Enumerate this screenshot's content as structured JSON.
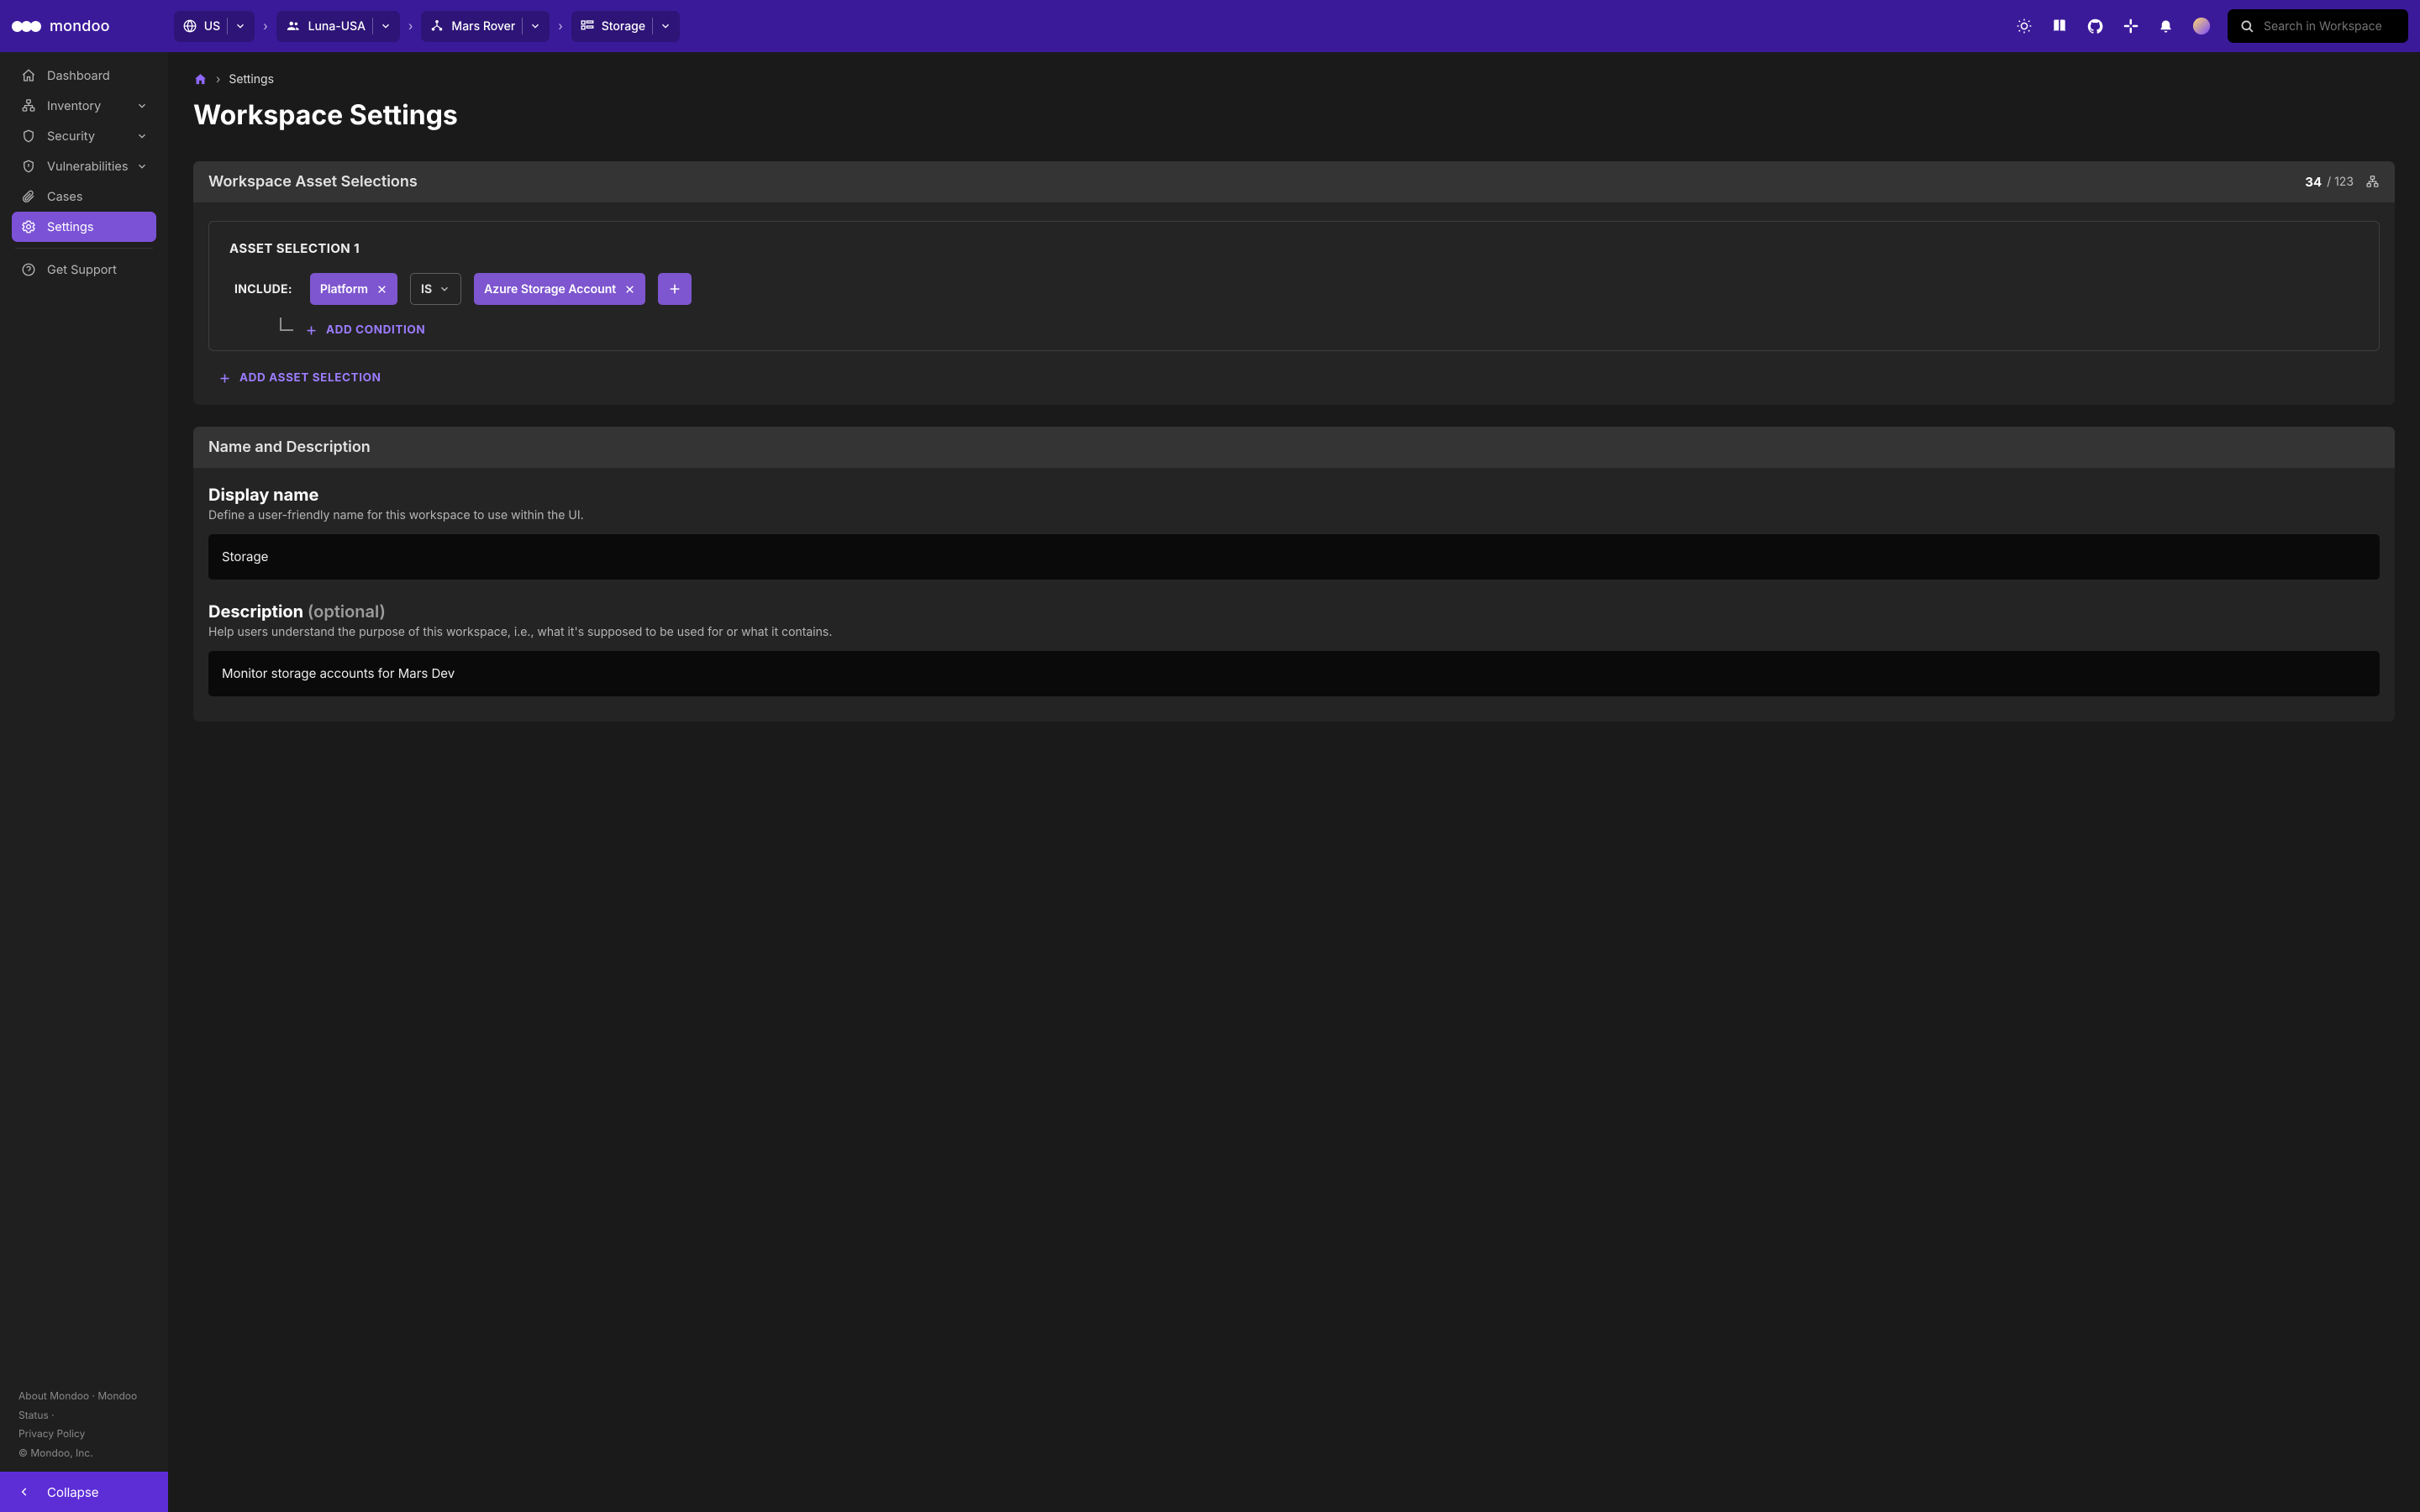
{
  "brand": "mondoo",
  "crumbs": [
    {
      "icon": "globe",
      "label": "US"
    },
    {
      "icon": "group",
      "label": "Luna-USA"
    },
    {
      "icon": "tree",
      "label": "Mars Rover"
    },
    {
      "icon": "workspace",
      "label": "Storage"
    }
  ],
  "search_placeholder": "Search in Workspace",
  "sidebar": {
    "items": [
      {
        "icon": "home",
        "label": "Dashboard",
        "expandable": false
      },
      {
        "icon": "inv",
        "label": "Inventory",
        "expandable": true
      },
      {
        "icon": "shield",
        "label": "Security",
        "expandable": true
      },
      {
        "icon": "bug",
        "label": "Vulnerabilities",
        "expandable": true
      },
      {
        "icon": "clip",
        "label": "Cases",
        "expandable": false
      },
      {
        "icon": "gear",
        "label": "Settings",
        "expandable": false,
        "active": true
      },
      {
        "icon": "help",
        "label": "Get Support",
        "expandable": false
      }
    ],
    "footer": {
      "about": "About Mondoo",
      "status": "Mondoo Status",
      "privacy": "Privacy Policy",
      "copyright": "© Mondoo, Inc."
    },
    "collapse": "Collapse"
  },
  "breadcrumb": "Settings",
  "page_title": "Workspace Settings",
  "selections_card": {
    "title": "Workspace Asset Selections",
    "count": "34",
    "total": "/ 123",
    "selection_label": "ASSET SELECTION 1",
    "include_label": "INCLUDE:",
    "chip_key": "Platform",
    "operator": "IS",
    "chip_value": "Azure Storage Account",
    "add_condition": "ADD CONDITION",
    "add_selection": "ADD ASSET SELECTION"
  },
  "name_card": {
    "title": "Name and Description",
    "display_name_label": "Display name",
    "display_name_sub": "Define a user-friendly name for this workspace to use within the UI.",
    "display_name_value": "Storage",
    "description_label": "Description",
    "description_opt": "(optional)",
    "description_sub": "Help users understand the purpose of this workspace, i.e., what it's supposed to be used for or what it contains.",
    "description_value": "Monitor storage accounts for Mars Dev"
  }
}
